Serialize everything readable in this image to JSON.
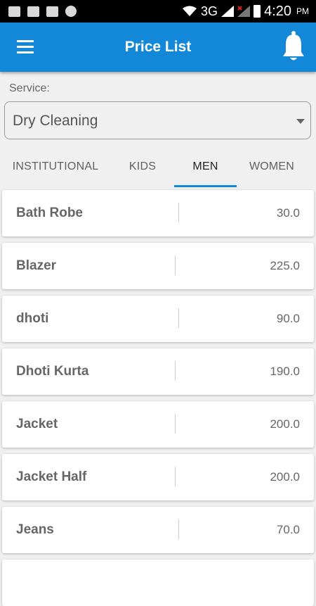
{
  "status_bar": {
    "network": "3G",
    "time": "4:20",
    "ampm": "PM"
  },
  "app_bar": {
    "title": "Price List",
    "icons": [
      "menu-icon",
      "bell-icon"
    ]
  },
  "service": {
    "label": "Service:",
    "selected": "Dry Cleaning"
  },
  "tabs": [
    {
      "label": "INSTITUTIONAL",
      "active": false
    },
    {
      "label": "KIDS",
      "active": false
    },
    {
      "label": "MEN",
      "active": true
    },
    {
      "label": "WOMEN",
      "active": false
    }
  ],
  "items": [
    {
      "name": "Bath Robe",
      "price": "30.0"
    },
    {
      "name": "Blazer",
      "price": "225.0"
    },
    {
      "name": "dhoti",
      "price": "90.0"
    },
    {
      "name": "Dhoti Kurta",
      "price": "190.0"
    },
    {
      "name": "Jacket",
      "price": "200.0"
    },
    {
      "name": "Jacket Half",
      "price": "200.0"
    },
    {
      "name": "Jeans",
      "price": "70.0"
    }
  ],
  "colors": {
    "primary": "#1387d8",
    "background": "#f0f0f0",
    "text": "#666666"
  }
}
